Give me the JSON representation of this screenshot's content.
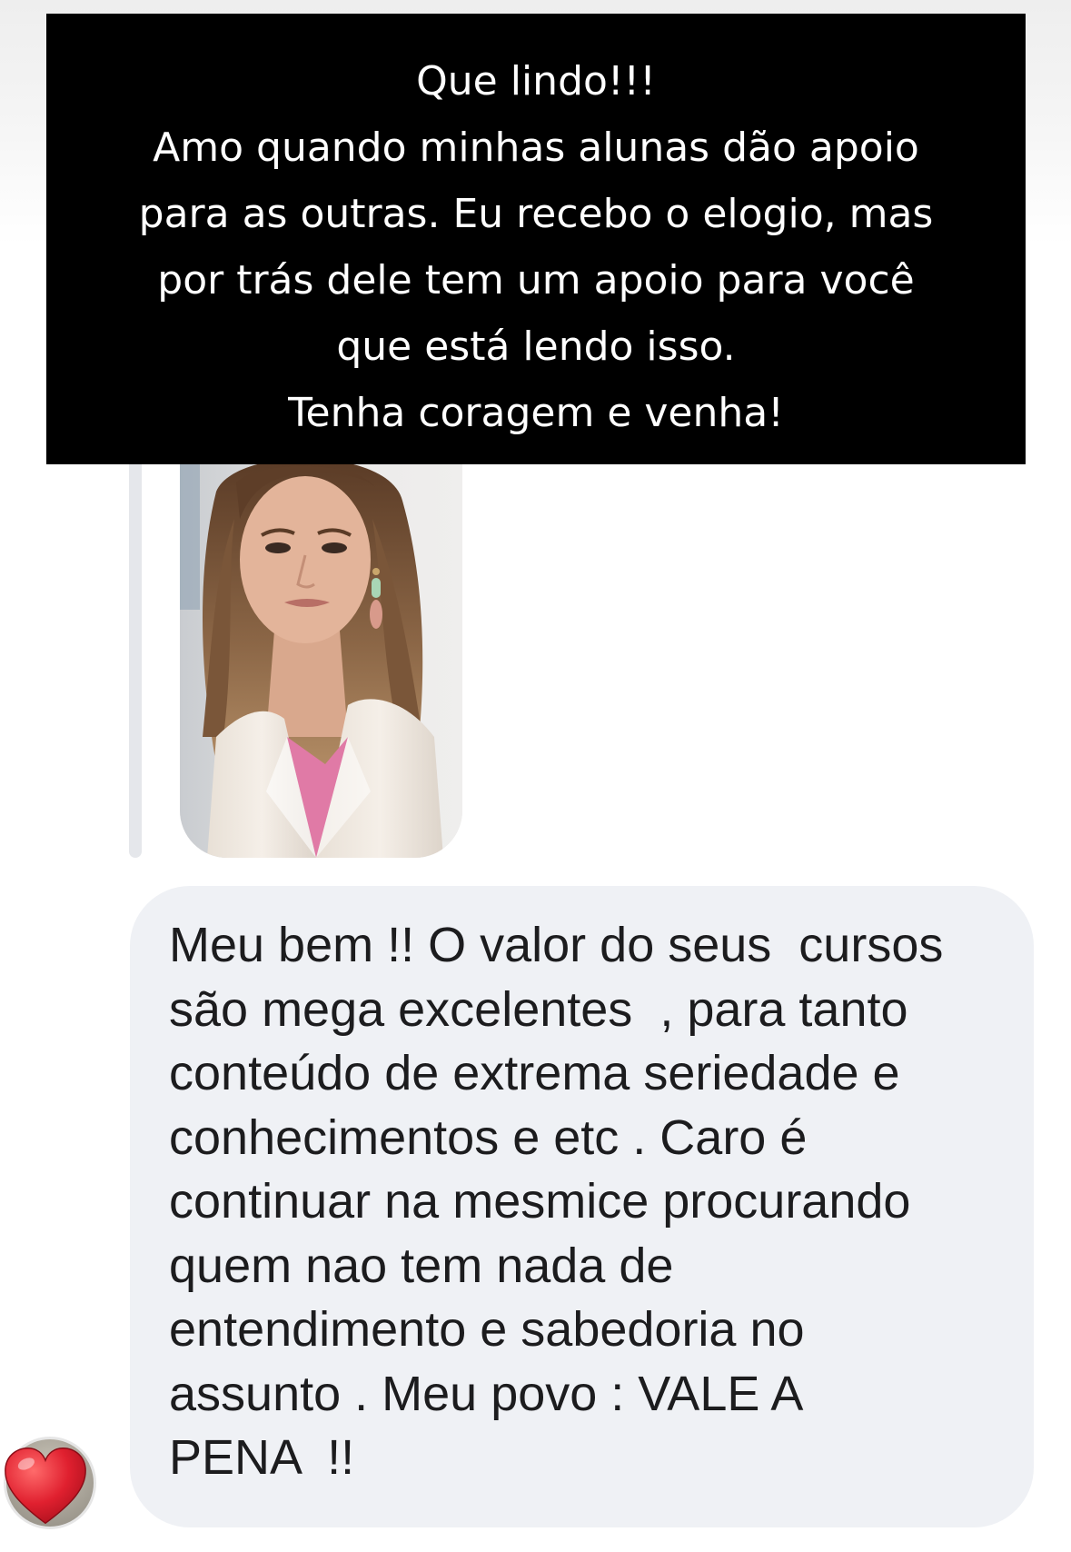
{
  "story_caption": {
    "lines": [
      "Que lindo!!!",
      "Amo quando minhas alunas dão apoio",
      "para as outras. Eu recebo o elogio, mas",
      "por trás dele tem um apoio para você",
      "que está lendo isso.",
      "Tenha coragem e venha!"
    ]
  },
  "story_reply": {
    "thumbnail_icon": "story-video-thumbnail"
  },
  "message": {
    "lines": [
      "Meu bem !! O valor do seus  cursos",
      "são mega excelentes  , para tanto",
      "conteúdo de extrema seriedade e",
      "conhecimentos e etc . Caro é",
      "continuar na mesmice procurando",
      "quem nao tem nada de",
      "entendimento e sabedoria no",
      "assunto . Meu povo : VALE A",
      "PENA  !!"
    ]
  },
  "reaction": {
    "icon": "red-heart-icon",
    "color": "#e0202f"
  },
  "colors": {
    "caption_bg": "#000000",
    "caption_text": "#ffffff",
    "bubble_bg": "#eff1f5",
    "bubble_text": "#1c1c1e"
  }
}
